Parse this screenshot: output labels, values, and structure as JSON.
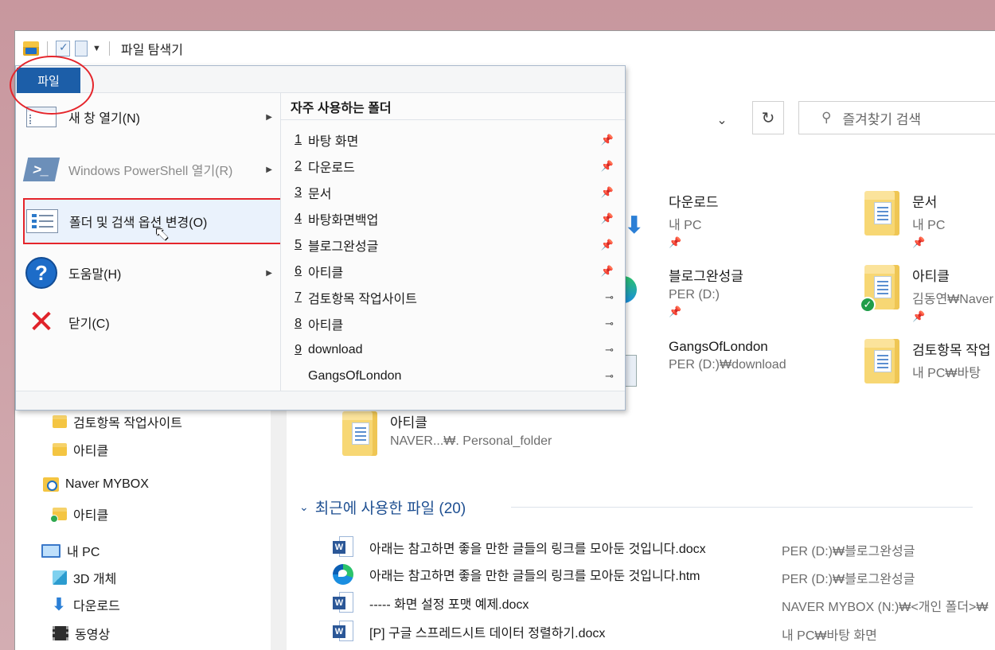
{
  "window": {
    "title": "파일 탐색기"
  },
  "file_tab": "파일",
  "menu": {
    "left_items": [
      {
        "label": "새 창 열기(N)",
        "icon": "new-window-icon",
        "has_submenu": true,
        "disabled": false
      },
      {
        "label": "Windows PowerShell 열기(R)",
        "icon": "powershell-icon",
        "has_submenu": true,
        "disabled": true
      },
      {
        "label": "폴더 및 검색 옵션 변경(O)",
        "icon": "folder-options-icon",
        "has_submenu": false,
        "disabled": false
      },
      {
        "label": "도움말(H)",
        "icon": "help-icon",
        "has_submenu": true,
        "disabled": false
      },
      {
        "label": "닫기(C)",
        "icon": "close-icon",
        "has_submenu": false,
        "disabled": false
      }
    ],
    "frequent_header": "자주 사용하는 폴더",
    "frequent_folders": [
      {
        "num": "1",
        "name": "바탕 화면",
        "pinned": true
      },
      {
        "num": "2",
        "name": "다운로드",
        "pinned": true
      },
      {
        "num": "3",
        "name": "문서",
        "pinned": true
      },
      {
        "num": "4",
        "name": "바탕화면백업",
        "pinned": true
      },
      {
        "num": "5",
        "name": "블로그완성글",
        "pinned": true
      },
      {
        "num": "6",
        "name": "아티클",
        "pinned": true
      },
      {
        "num": "7",
        "name": "검토항목 작업사이트",
        "pinned": false
      },
      {
        "num": "8",
        "name": "아티클",
        "pinned": false
      },
      {
        "num": "9",
        "name": "download",
        "pinned": false
      },
      {
        "num": "",
        "name": "GangsOfLondon",
        "pinned": false
      }
    ]
  },
  "search": {
    "placeholder": "즐겨찾기 검색"
  },
  "quick_access_tiles": [
    {
      "name": "다운로드",
      "location": "내 PC",
      "pinned": true
    },
    {
      "name": "문서",
      "location": "내 PC",
      "pinned": true
    },
    {
      "name": "블로그완성글",
      "location": "PER (D:)",
      "pinned": true
    },
    {
      "name": "아티클",
      "location": "김동연₩Naver",
      "pinned": true,
      "synced": true
    },
    {
      "name": "GangsOfLondon",
      "location": "PER (D:)₩download",
      "pinned": false
    },
    {
      "name": "검토항목 작업",
      "location": "내 PC₩바탕",
      "pinned": false
    },
    {
      "name": "아티클",
      "location": "NAVER...₩. Personal_folder",
      "pinned": false
    }
  ],
  "nav": {
    "items": [
      {
        "label": "검토항목 작업사이트",
        "icon": "folder-icon"
      },
      {
        "label": "아티클",
        "icon": "folder-icon"
      },
      {
        "label": "Naver MYBOX",
        "icon": "mybox-icon"
      },
      {
        "label": "아티클",
        "icon": "folder-synced-icon"
      },
      {
        "label": "내 PC",
        "icon": "pc-icon"
      },
      {
        "label": "3D 개체",
        "icon": "cube-icon"
      },
      {
        "label": "다운로드",
        "icon": "download-icon"
      },
      {
        "label": "동영상",
        "icon": "video-icon"
      }
    ]
  },
  "recent": {
    "header": "최근에 사용한 파일 (20)",
    "files": [
      {
        "name": "아래는 참고하면 좋을 만한 글들의 링크를 모아둔 것입니다.docx",
        "location": "PER (D:)₩블로그완성글",
        "icon": "word-icon"
      },
      {
        "name": "아래는 참고하면 좋을 만한 글들의 링크를 모아둔 것입니다.htm",
        "location": "PER (D:)₩블로그완성글",
        "icon": "edge-icon"
      },
      {
        "name": "----- 화면 설정 포맷 예제.docx",
        "location": "NAVER MYBOX (N:)₩<개인 폴더>₩",
        "icon": "word-icon"
      },
      {
        "name": "[P] 구글 스프레드시트 데이터 정렬하기.docx",
        "location": "내 PC₩바탕 화면",
        "icon": "word-icon"
      }
    ]
  },
  "colors": {
    "file_tab": "#1c5ea8",
    "annotation_red": "#e5252b",
    "accent_blue": "#1e4f91"
  }
}
